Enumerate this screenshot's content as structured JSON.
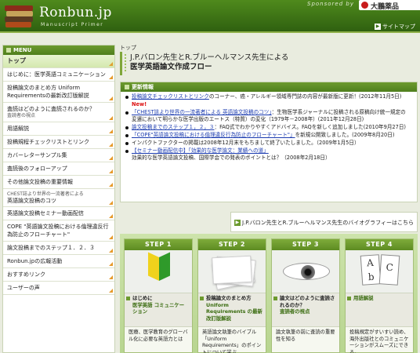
{
  "header": {
    "logo_title": "Ronbun.jp",
    "logo_subtitle": "Manuscript Primer",
    "sponsor_text": "Sponsored by",
    "sponsor_name": "大鵬薬品",
    "sitemap_label": "サイトマップ",
    "colors": {
      "header_green": "#3a7014",
      "accent_orange": "#e79a2a"
    }
  },
  "sidebar": {
    "menu_title": "MENU",
    "items": [
      {
        "label": "トップ",
        "sub": "",
        "active": true
      },
      {
        "label": "はじめに：医学英語コミュニケーション",
        "sub": ""
      },
      {
        "label": "投稿論文のまとめ方 Uniform Requirementsの最新改訂版解説",
        "sub": ""
      },
      {
        "label": "査読はどのように査読されるのか？",
        "sub": "査読者の視点"
      },
      {
        "label": "用語解説",
        "sub": ""
      },
      {
        "label": "投稿規程チェックリストとリンク",
        "sub": ""
      },
      {
        "label": "カバーレターサンプル集",
        "sub": ""
      },
      {
        "label": "査読後のフォローアップ",
        "sub": ""
      },
      {
        "label": "その他論文投稿の重要情報",
        "sub": ""
      },
      {
        "label": "CHEST誌より世界の一流著者による",
        "sub": "英語論文投稿のコツ"
      },
      {
        "label": "英語論文投稿セミナー動画配信",
        "sub": ""
      },
      {
        "label": "COPE \"英語論文投稿における倫理違反行為防止のフローチャート\"",
        "sub": ""
      },
      {
        "label": "論文投稿までのステップ１．２．３",
        "sub": ""
      },
      {
        "label": "Ronbun.jpの広報活動",
        "sub": ""
      },
      {
        "label": "おすすめリンク",
        "sub": ""
      },
      {
        "label": "ユーザーの声",
        "sub": ""
      }
    ]
  },
  "main": {
    "breadcrumb": "トップ",
    "title_line1": "J.P.バロン先生とR.ブルーヘルマンス先生による",
    "title_line2": "医学英語論文作成フロー",
    "news_title": "更新情報",
    "news": [
      {
        "link": "投稿論文チェックリストとリンク",
        "text": "のコーナー、癌・アレルギー領域専門誌の内容が最新版に更新！(2012年11月5日)",
        "new": "New!"
      },
      {
        "link": "「CHEST誌より世界の一流著者による 英語論文投稿のコツ」",
        "text": "：生物医学系ジャーナルに投稿される原稿向け統一規定の変遷において明らかな医学出版のエートス（特質）の変化（1979年－2008年）(2011年12月28日)",
        "new": ""
      },
      {
        "link": "論文投稿までのステップ１，２，３",
        "text": "：FAQ式でわかりやすくアドバイス。FAQを新しく追加しました(2010年9月27日)",
        "new": ""
      },
      {
        "link": "「COPE\"英語論文投稿における倫理違反行為防止のフローチャート\"」",
        "text": "を新規公開致しました。(2009年8月20日)",
        "new": ""
      },
      {
        "link": "",
        "text": "インパクトファクターの掲載は2008年12月末をもちまして終了いたしました。（2009年1月5日）",
        "new": ""
      },
      {
        "link": "【セミナー動画配信中】「効果的な医学論文：業績への道」",
        "text": "効果的な医学英語論文投稿、国際学会での発表のポイントとは？（2008年2月18日）",
        "new": ""
      }
    ],
    "bio_link": "J.P.バロン先生とR.ブルーヘルマンス先生のバイオグラフィーはこちら"
  },
  "steps": [
    {
      "head": "STEP 1",
      "pre": "はじめに",
      "main": "医学英語 コミュニケーション",
      "desc": "医療、医学教育のグローバル化に必要な英語力とは"
    },
    {
      "head": "STEP 2",
      "pre": "投稿論文のまとめ方",
      "main": "Uniform Requirements の最新改訂版解説",
      "desc": "英語論文執筆のバイブル「Uniform Requirements」のポイントについて学ぶ"
    },
    {
      "head": "STEP 3",
      "pre": "論文はどのように査読されるのか？",
      "main": "査読者の視点",
      "desc": "論文執筆の前に査読の重要性を知る"
    },
    {
      "head": "STEP 4",
      "pre": "",
      "main": "用語解説",
      "desc": "投稿規定がすいすい読め、海外出版社とのコミュニケーションがスムーズにできる。"
    }
  ]
}
